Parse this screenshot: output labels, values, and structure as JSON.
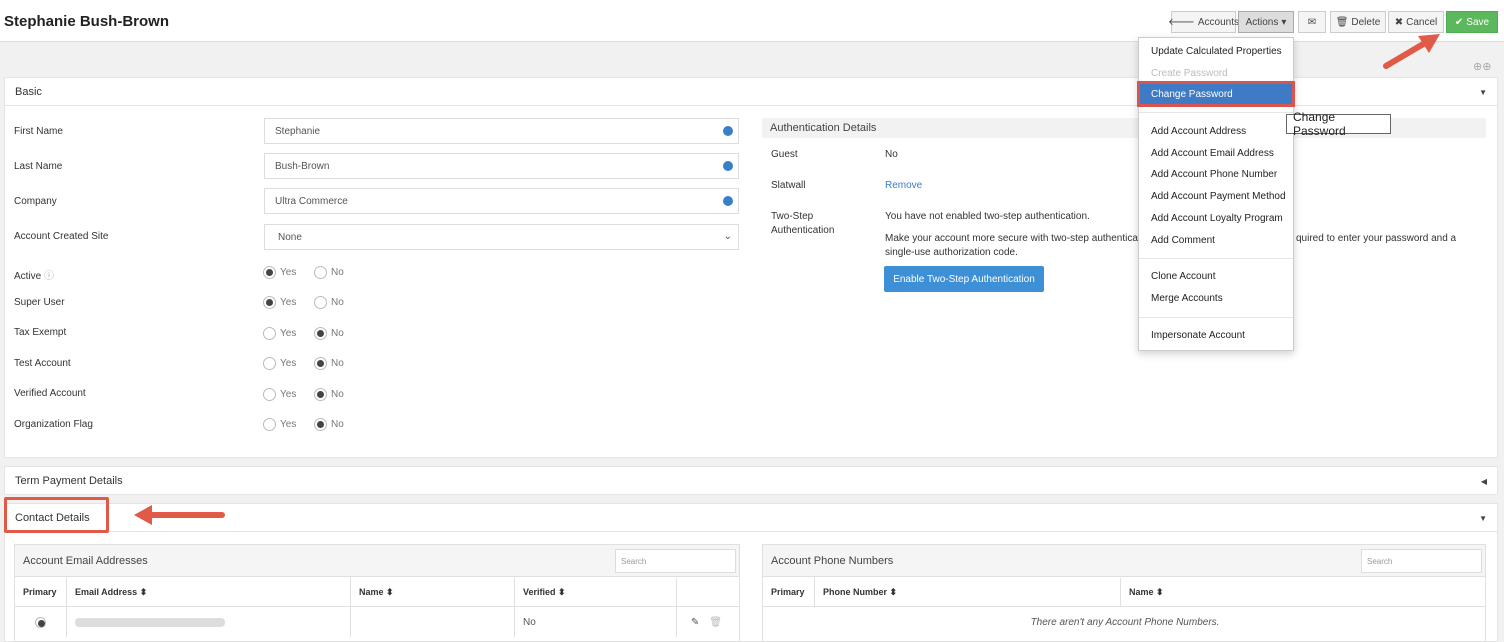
{
  "header": {
    "title": "Stephanie Bush-Brown",
    "accounts_label": "Accounts",
    "actions_label": "Actions",
    "delete_label": "Delete",
    "cancel_label": "Cancel",
    "save_label": "Save"
  },
  "actions_menu": {
    "items": [
      "Update Calculated Properties",
      "Create Password",
      "Change Password",
      "Add Account Address",
      "Add Account Email Address",
      "Add Account Phone Number",
      "Add Account Payment Method",
      "Add Account Loyalty Program",
      "Add Comment",
      "Clone Account",
      "Merge Accounts",
      "Impersonate Account"
    ],
    "tooltip": "Change Password"
  },
  "basic": {
    "title": "Basic",
    "first_name_label": "First Name",
    "first_name_value": "Stephanie",
    "last_name_label": "Last Name",
    "last_name_value": "Bush-Brown",
    "company_label": "Company",
    "company_value": "Ultra Commerce",
    "site_label": "Account Created Site",
    "site_value": "None",
    "yes": "Yes",
    "no": "No",
    "toggles": [
      {
        "label": "Active",
        "value": "Yes"
      },
      {
        "label": "Super User",
        "value": "Yes"
      },
      {
        "label": "Tax Exempt",
        "value": "No"
      },
      {
        "label": "Test Account",
        "value": "No"
      },
      {
        "label": "Verified Account",
        "value": "No"
      },
      {
        "label": "Organization Flag",
        "value": "No"
      }
    ]
  },
  "auth": {
    "title": "Authentication Details",
    "guest_label": "Guest",
    "guest_value": "No",
    "slatwall_label": "Slatwall",
    "slatwall_value": "Remove",
    "twostep_label_1": "Two-Step",
    "twostep_label_2": "Authentication",
    "twostep_status": "You have not enabled two-step authentication.",
    "twostep_desc_1": "Make your account more secure with two-step authentica",
    "twostep_desc_1b": "quired to enter your password and a",
    "twostep_desc_2": "single-use authorization code.",
    "enable_button": "Enable Two-Step Authentication"
  },
  "term": {
    "title": "Term Payment Details"
  },
  "contact": {
    "title": "Contact Details",
    "emails": {
      "title": "Account Email Addresses",
      "search_placeholder": "Search",
      "headers": [
        "Primary",
        "Email Address ⬍",
        "Name ⬍",
        "Verified ⬍"
      ],
      "row_verified": "No"
    },
    "phones": {
      "title": "Account Phone Numbers",
      "search_placeholder": "Search",
      "headers": [
        "Primary",
        "Phone Number ⬍",
        "Name ⬍"
      ],
      "empty": "There aren't any Account Phone Numbers."
    }
  },
  "colors": {
    "accent": "#3e7bc4",
    "save": "#5cb85c",
    "annotation": "#e05a47"
  }
}
